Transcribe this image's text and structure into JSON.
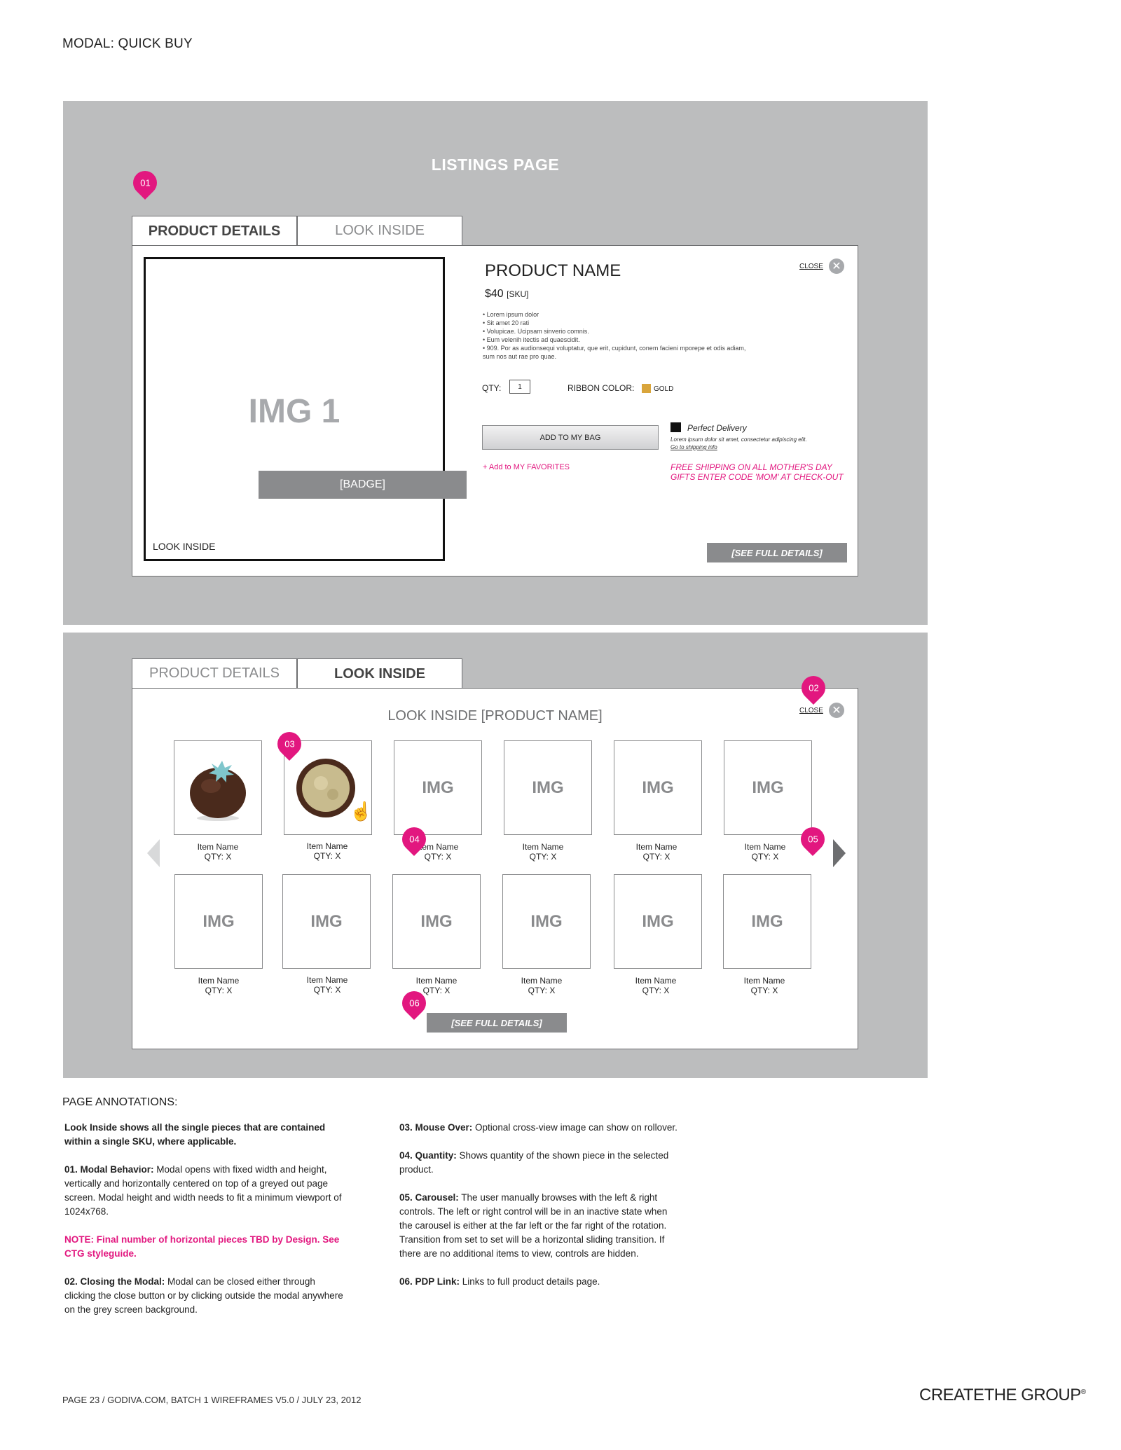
{
  "doc": {
    "title": "MODAL: QUICK BUY"
  },
  "listings": {
    "title": "LISTINGS PAGE",
    "tabs": [
      "PRODUCT DETAILS",
      "LOOK INSIDE"
    ],
    "image_label": "IMG 1",
    "badge": "[BADGE]",
    "look_inside_link": "LOOK INSIDE",
    "product_name": "PRODUCT NAME",
    "price": "$40",
    "sku": "[SKU]",
    "close_label": "CLOSE",
    "description": [
      "• Lorem ipsum dolor",
      "• Sit amet 20 rati",
      "• Volupicae. Ucipsam sinverio comnis.",
      "• Eum velenih itectis ad quaescidit.",
      "• 909. Por as audionsequi voluptatur, que erit, cupidunt, conem facieni mporepe et odis adiam,",
      "  sum nos aut rae pro quae."
    ],
    "qty_label": "QTY:",
    "qty_value": "1",
    "ribbon_label": "RIBBON COLOR:",
    "ribbon_value": "GOLD",
    "ribbon_color": "#d9a53b",
    "add_to_bag": "ADD TO MY BAG",
    "add_favorites": "+ Add to MY FAVORITES",
    "delivery_title": "Perfect Delivery",
    "delivery_copy": "Lorem ipsum dolor sit amet, consectetur adipiscing elit.",
    "delivery_link": "Go to shipping info",
    "promo": "FREE SHIPPING ON ALL MOTHER'S DAY GIFTS  ENTER CODE 'MOM' AT CHECK-OUT",
    "see_full": "[SEE FULL DETAILS]"
  },
  "look_inside": {
    "tabs": [
      "PRODUCT DETAILS",
      "LOOK INSIDE"
    ],
    "title": "LOOK INSIDE [PRODUCT NAME]",
    "close_label": "CLOSE",
    "see_full": "[SEE FULL DETAILS]",
    "row1": [
      {
        "label": "",
        "name": "Item Name",
        "qty": "QTY: X"
      },
      {
        "label": "",
        "name": "Item Name",
        "qty": "QTY: X"
      },
      {
        "label": "IMG",
        "name": "Item Name",
        "qty": "QTY: X"
      },
      {
        "label": "IMG",
        "name": "Item Name",
        "qty": "QTY: X"
      },
      {
        "label": "IMG",
        "name": "Item Name",
        "qty": "QTY: X"
      },
      {
        "label": "IMG",
        "name": "Item Name",
        "qty": "QTY: X"
      }
    ],
    "row2": [
      {
        "label": "IMG",
        "name": "Item Name",
        "qty": "QTY: X"
      },
      {
        "label": "IMG",
        "name": "Item Name",
        "qty": "QTY: X"
      },
      {
        "label": "IMG",
        "name": "Item Name",
        "qty": "QTY: X"
      },
      {
        "label": "IMG",
        "name": "Item Name",
        "qty": "QTY: X"
      },
      {
        "label": "IMG",
        "name": "Item Name",
        "qty": "QTY: X"
      },
      {
        "label": "IMG",
        "name": "Item Name",
        "qty": "QTY: X"
      }
    ]
  },
  "markers": [
    "01",
    "02",
    "03",
    "04",
    "05",
    "06"
  ],
  "annotations": {
    "title": "PAGE ANNOTATIONS:",
    "intro": "Look Inside shows all the single pieces that are contained within a single SKU, where applicable.",
    "a01_head": "01.  Modal Behavior:",
    "a01_body": " Modal opens with fixed width and height, vertically and horizontally centered on top of a greyed out page screen. Modal height and width needs to fit a minimum viewport of 1024x768.",
    "note": "NOTE: Final number of horizontal pieces TBD by Design. See CTG styleguide.",
    "a02_head": "02.  Closing the Modal:",
    "a02_body": " Modal can be closed either through clicking the close button or by clicking outside the modal anywhere on the grey screen background.",
    "a03_head": "03.  Mouse Over:",
    "a03_body": " Optional cross-view image can show on rollover.",
    "a04_head": "04.  Quantity:",
    "a04_body": " Shows quantity of the shown piece in the selected product.",
    "a05_head": "05.  Carousel:",
    "a05_body": " The user manually browses with the left & right controls. The left or right control will be in an inactive state when the carousel is either at the far left or the far right of the rotation. Transition from set to set will be a horizontal sliding transition. If there are no additional items to view, controls are hidden.",
    "a06_head": "06.  PDP Link:",
    "a06_body": " Links to full product details page."
  },
  "footer": {
    "text": "PAGE 23  /  GODIVA.COM, BATCH 1 WIREFRAMES V5.0 / JULY 23, 2012",
    "logo": "CREATETHE GROUP",
    "logo_mark": "®"
  }
}
